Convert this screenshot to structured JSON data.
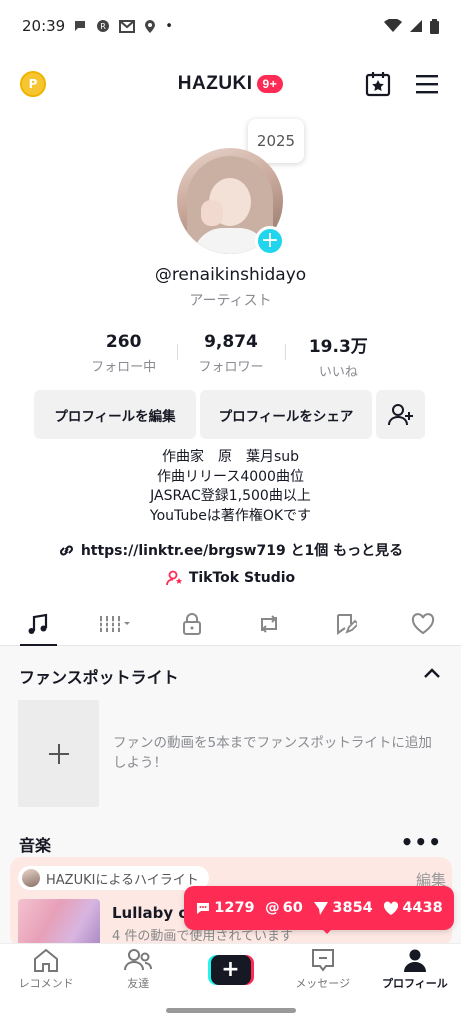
{
  "status": {
    "time": "20:39",
    "dot": "•"
  },
  "header": {
    "title": "HAZUKI",
    "badge": "9+"
  },
  "profile": {
    "year_bubble": "2025",
    "username": "@renaikinshidayo",
    "role": "アーティスト",
    "stats": [
      {
        "num": "260",
        "label": "フォロー中"
      },
      {
        "num": "9,874",
        "label": "フォロワー"
      },
      {
        "num": "19.3万",
        "label": "いいね"
      }
    ],
    "buttons": {
      "edit": "プロフィールを編集",
      "share": "プロフィールをシェア"
    },
    "bio": [
      "作曲家　原　葉月sub",
      "作曲リリース4000曲位",
      "JASRAC登録1,500曲以上",
      "YouTubeは著作権OKです"
    ],
    "link": "https://linktr.ee/brgsw719 と1個 もっと見る",
    "studio": "TikTok Studio"
  },
  "fan_spotlight": {
    "title": "ファンスポットライト",
    "description": "ファンの動画を5本までファンスポットライトに追加しよう！"
  },
  "music": {
    "title": "音楽",
    "more": "•••",
    "highlight_label": "HAZUKIによるハイライト",
    "edit": "編集",
    "song_title": "Lullaby o",
    "song_sub": "4 件の動画で使用されています"
  },
  "counters": {
    "comments": "1279",
    "mentions": "60",
    "shares": "3854",
    "likes": "4438"
  },
  "bottom_nav": {
    "home": "レコメンド",
    "friends": "友達",
    "inbox": "メッセージ",
    "profile": "プロフィール"
  },
  "colors": {
    "accent": "#fe2c55",
    "cyan": "#20d5ec"
  }
}
